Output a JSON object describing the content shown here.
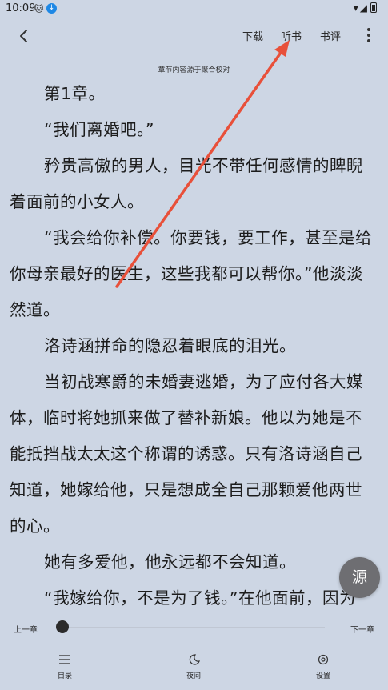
{
  "status_bar": {
    "time": "10:09",
    "icons": [
      "cat-icon",
      "download-notify-icon",
      "wifi-icon",
      "signal-icon",
      "battery-icon"
    ]
  },
  "toolbar": {
    "back_icon": "chevron-left-icon",
    "download_label": "下载",
    "listen_label": "听书",
    "review_label": "书评",
    "more_icon": "more-vertical-icon"
  },
  "reader": {
    "source_note": "章节内容源于聚合校对",
    "paragraphs": [
      {
        "text": "第1章。",
        "continued": false
      },
      {
        "text": "“我们离婚吧。”",
        "continued": false
      },
      {
        "text": "矜贵高傲的男人，目光不带任何感情的睥睨着面前的小女人。",
        "continued": false
      },
      {
        "text": "“我会给你补偿。你要钱，要工作，甚至是给你母亲最好的医生，这些我都可以帮你。”他淡淡然道。",
        "continued": false
      },
      {
        "text": "洛诗涵拼命的隐忍着眼底的泪光。",
        "continued": false
      },
      {
        "text": "当初战寒爵的未婚妻逃婚，为了应付各大媒体，临时将她抓来做了替补新娘。他以为她是不能抵挡战太太这个称谓的诱惑。只有洛诗涵自己知道，她嫁给他，只是想成全自己那颗爱他两世的心。",
        "continued": false
      },
      {
        "text": "她有多爱他，他永远都不会知道。",
        "continued": false
      },
      {
        "text": "“我嫁给你，不是为了钱。”在他面前，因为",
        "continued": false
      }
    ],
    "source_button": "源"
  },
  "bottom_panel": {
    "prev_chapter": "上一章",
    "next_chapter": "下一章",
    "progress": 0.0,
    "nav": {
      "toc": "目录",
      "night": "夜间",
      "settings": "设置"
    }
  },
  "colors": {
    "background": "#cdd6e4",
    "text": "#1c1c1c",
    "fab": "#6e6e72",
    "annotation_arrow": "#e8503a"
  }
}
